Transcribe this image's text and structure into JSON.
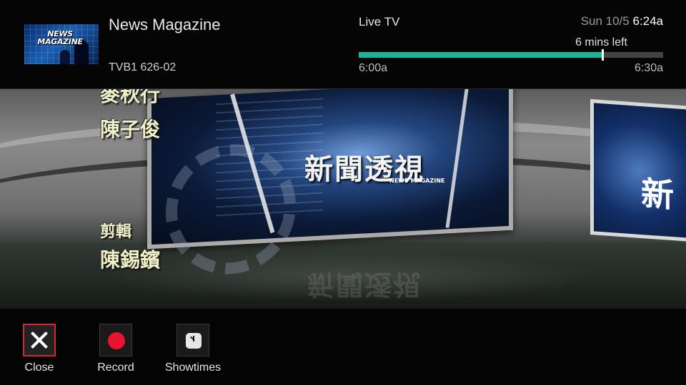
{
  "header": {
    "program_title": "News Magazine",
    "channel": "TVB1 626-02",
    "thumbnail_logo_text": "NEWS MAGAZINE",
    "live_label": "Live TV",
    "date": "Sun 10/5",
    "time": "6:24a",
    "remaining": "6 mins left",
    "start_time": "6:00a",
    "end_time": "6:30a",
    "progress_fraction": 0.8,
    "progress_color": "#19b596"
  },
  "video": {
    "credits": [
      "麥秋行",
      "陳子俊",
      "剪輯",
      "陳錫鑌"
    ],
    "title_cn": "新聞透視",
    "title_en": "NEWS MAGAZINE",
    "right_screen_text": "新"
  },
  "controls": [
    {
      "label": "Close",
      "icon": "close-icon",
      "focused": true,
      "focus_color": "#d8262f"
    },
    {
      "label": "Record",
      "icon": "record-icon",
      "color": "#e8132d"
    },
    {
      "label": "Showtimes",
      "icon": "clock-icon"
    }
  ]
}
